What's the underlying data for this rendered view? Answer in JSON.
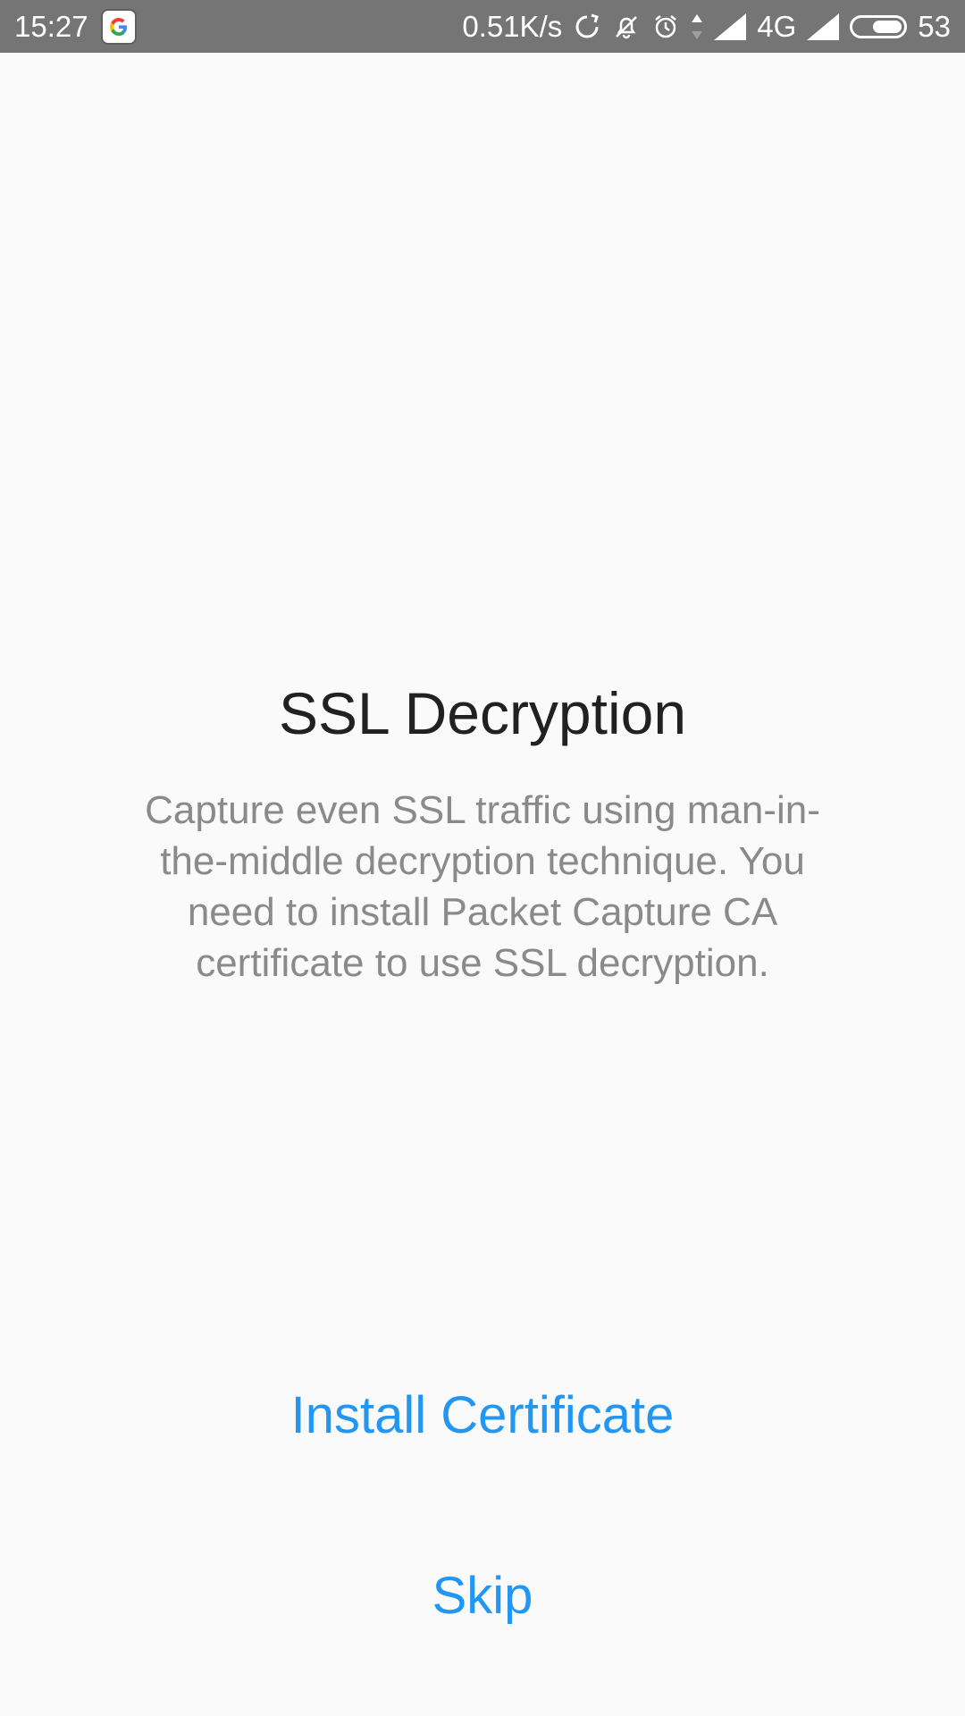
{
  "status_bar": {
    "time": "15:27",
    "network_speed": "0.51K/s",
    "network_type": "4G",
    "battery": "53",
    "icons": [
      "google-icon",
      "sync-icon",
      "bell-off-icon",
      "alarm-icon",
      "data-arrows-icon",
      "signal-icon",
      "signal-icon-2",
      "battery-icon"
    ]
  },
  "main": {
    "title": "SSL Decryption",
    "description": "Capture even SSL traffic using man-in-the-middle decryption technique. You need to install Packet Capture CA certificate to use SSL decryption."
  },
  "actions": {
    "install_label": "Install Certificate",
    "skip_label": "Skip"
  },
  "colors": {
    "accent": "#2196f3",
    "status_bar": "#757575",
    "background": "#fafafa"
  }
}
